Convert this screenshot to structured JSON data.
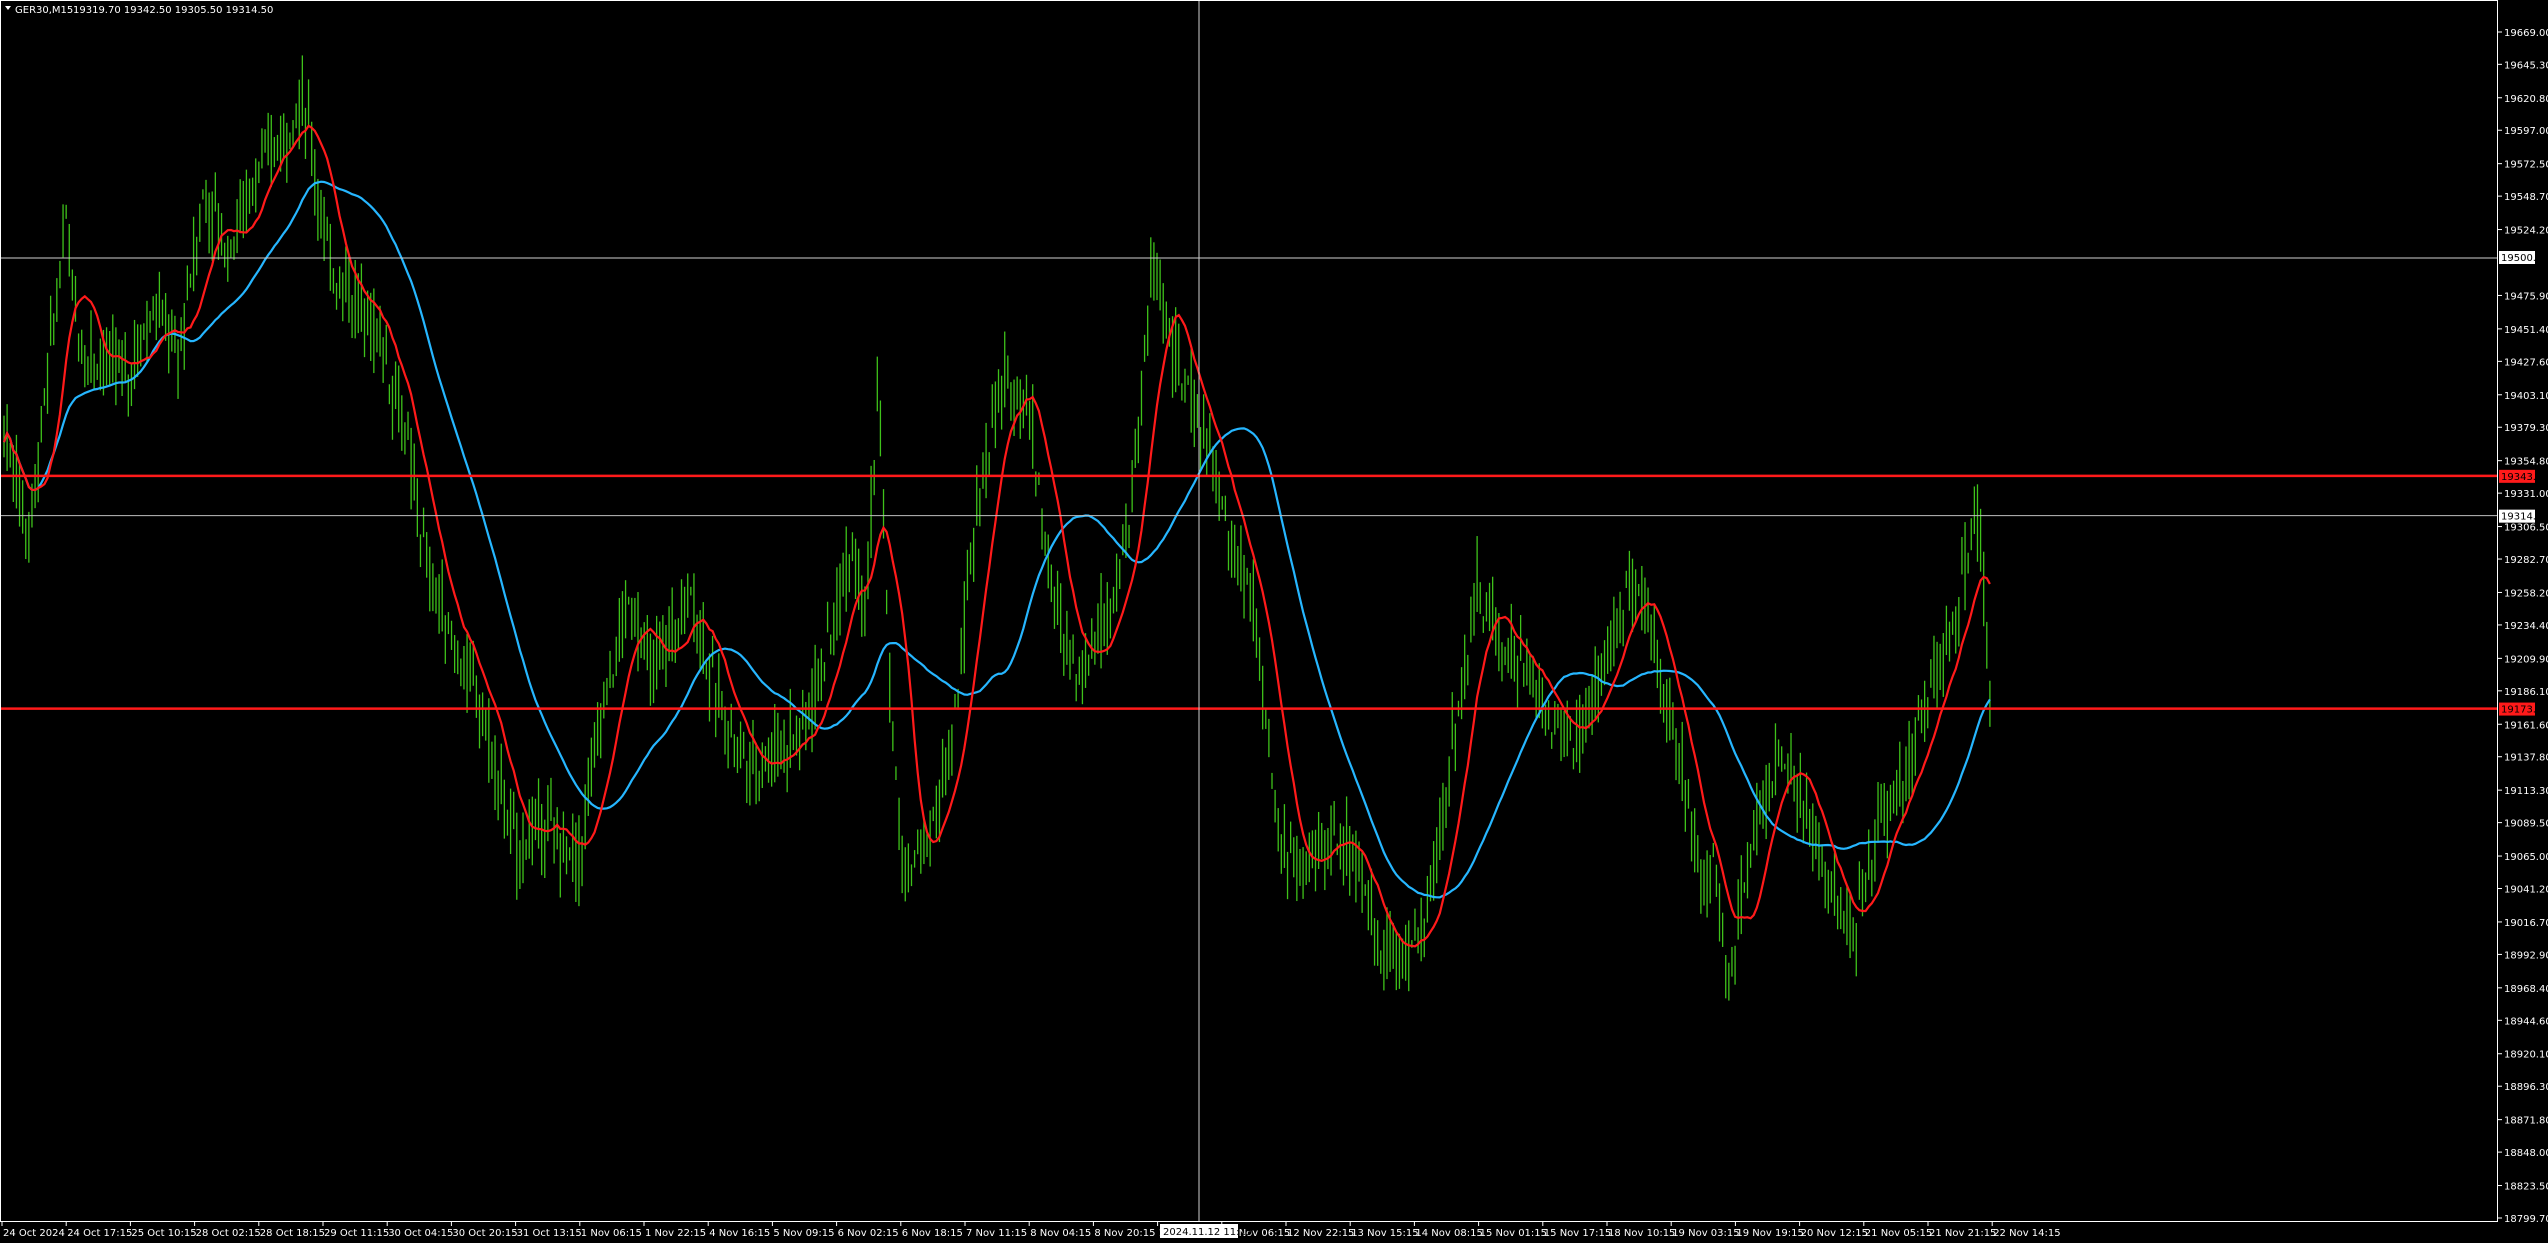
{
  "header": {
    "symbol": "GER30,M15",
    "ohlc": "19319.70 19342.50 19305.50 19314.50"
  },
  "crosshair": {
    "time_label": "2024.11.12 11:15",
    "price_label": "19500.61"
  },
  "colors": {
    "background": "#000000",
    "candles": "#3ec21a",
    "ma_fast": "#ff1a1a",
    "ma_slow": "#26b6ff",
    "hline": "#ff1a1a",
    "crosshair": "#cfcfcf",
    "axis": "#ffffff"
  },
  "price_axis": {
    "ticks": [
      "19669.00",
      "19645.30",
      "19620.80",
      "19597.00",
      "19572.50",
      "19548.70",
      "19524.20",
      "19475.90",
      "19451.40",
      "19427.60",
      "19403.10",
      "19379.30",
      "19354.80",
      "19331.00",
      "19306.50",
      "19282.70",
      "19258.20",
      "19234.40",
      "19209.90",
      "19186.10",
      "19161.60",
      "19137.80",
      "19113.30",
      "19089.50",
      "19065.00",
      "19041.20",
      "19016.70",
      "18992.90",
      "18968.40",
      "18944.60",
      "18920.10",
      "18896.30",
      "18871.80",
      "18848.00",
      "18823.50",
      "18799.70"
    ]
  },
  "time_axis": {
    "labels": [
      "24 Oct 2024",
      "24 Oct 17:15",
      "25 Oct 10:15",
      "28 Oct 02:15",
      "28 Oct 18:15",
      "29 Oct 11:15",
      "30 Oct 04:15",
      "30 Oct 20:15",
      "31 Oct 13:15",
      "1 Nov 06:15",
      "1 Nov 22:15",
      "4 Nov 16:15",
      "5 Nov 09:15",
      "6 Nov 02:15",
      "6 Nov 18:15",
      "7 Nov 11:15",
      "8 Nov 04:15",
      "8 Nov 20:15",
      "11 Nov 13:15",
      "12 Nov 06:15",
      "12 Nov 22:15",
      "13 Nov 15:15",
      "14 Nov 08:15",
      "15 Nov 01:15",
      "15 Nov 17:15",
      "18 Nov 10:15",
      "19 Nov 03:15",
      "19 Nov 19:15",
      "20 Nov 12:15",
      "21 Nov 05:15",
      "21 Nov 21:15",
      "22 Nov 14:15"
    ]
  },
  "levels": {
    "resistance": "19343.68",
    "support": "19173.10",
    "current": "19314.50"
  },
  "chart_data": {
    "type": "candlestick",
    "symbol": "GER30",
    "timeframe": "M15",
    "ylim": [
      18799.7,
      19669.0
    ],
    "x_range": [
      "24 Oct 2024",
      "22 Nov 14:15"
    ],
    "last_bar": {
      "open": 19319.7,
      "high": 19342.5,
      "low": 19305.5,
      "close": 19314.5
    },
    "horizontal_lines": [
      {
        "price": 19343.68,
        "color": "red"
      },
      {
        "price": 19173.1,
        "color": "red"
      }
    ],
    "price_path": [
      [
        0,
        19380
      ],
      [
        0.01,
        19300
      ],
      [
        0.02,
        19460
      ],
      [
        0.025,
        19530
      ],
      [
        0.03,
        19440
      ],
      [
        0.05,
        19420
      ],
      [
        0.06,
        19470
      ],
      [
        0.07,
        19430
      ],
      [
        0.08,
        19550
      ],
      [
        0.09,
        19510
      ],
      [
        0.1,
        19560
      ],
      [
        0.12,
        19620
      ],
      [
        0.13,
        19500
      ],
      [
        0.15,
        19450
      ],
      [
        0.16,
        19380
      ],
      [
        0.17,
        19270
      ],
      [
        0.18,
        19220
      ],
      [
        0.19,
        19180
      ],
      [
        0.205,
        19070
      ],
      [
        0.215,
        19090
      ],
      [
        0.23,
        19060
      ],
      [
        0.24,
        19180
      ],
      [
        0.25,
        19250
      ],
      [
        0.26,
        19200
      ],
      [
        0.275,
        19260
      ],
      [
        0.285,
        19180
      ],
      [
        0.3,
        19130
      ],
      [
        0.32,
        19160
      ],
      [
        0.33,
        19220
      ],
      [
        0.34,
        19300
      ],
      [
        0.345,
        19250
      ],
      [
        0.35,
        19410
      ],
      [
        0.355,
        19170
      ],
      [
        0.36,
        19050
      ],
      [
        0.37,
        19080
      ],
      [
        0.38,
        19150
      ],
      [
        0.39,
        19330
      ],
      [
        0.4,
        19410
      ],
      [
        0.41,
        19400
      ],
      [
        0.42,
        19250
      ],
      [
        0.43,
        19200
      ],
      [
        0.44,
        19240
      ],
      [
        0.45,
        19300
      ],
      [
        0.46,
        19500
      ],
      [
        0.47,
        19420
      ],
      [
        0.48,
        19380
      ],
      [
        0.49,
        19300
      ],
      [
        0.5,
        19250
      ],
      [
        0.51,
        19080
      ],
      [
        0.52,
        19050
      ],
      [
        0.53,
        19080
      ],
      [
        0.54,
        19070
      ],
      [
        0.55,
        19000
      ],
      [
        0.56,
        18990
      ],
      [
        0.57,
        19020
      ],
      [
        0.58,
        19150
      ],
      [
        0.59,
        19260
      ],
      [
        0.6,
        19220
      ],
      [
        0.61,
        19200
      ],
      [
        0.62,
        19160
      ],
      [
        0.63,
        19150
      ],
      [
        0.64,
        19200
      ],
      [
        0.65,
        19260
      ],
      [
        0.66,
        19230
      ],
      [
        0.67,
        19140
      ],
      [
        0.68,
        19050
      ],
      [
        0.685,
        19060
      ],
      [
        0.69,
        18970
      ],
      [
        0.7,
        19080
      ],
      [
        0.71,
        19140
      ],
      [
        0.72,
        19100
      ],
      [
        0.73,
        19050
      ],
      [
        0.74,
        19000
      ],
      [
        0.75,
        19090
      ],
      [
        0.76,
        19120
      ],
      [
        0.77,
        19180
      ],
      [
        0.78,
        19230
      ],
      [
        0.79,
        19320
      ],
      [
        0.795,
        19180
      ]
    ]
  }
}
